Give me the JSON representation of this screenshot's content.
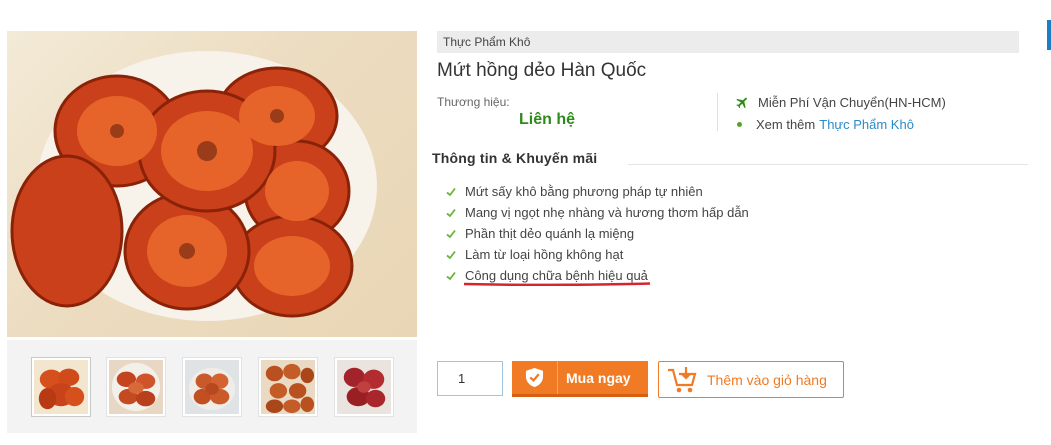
{
  "product": {
    "category": "Thực Phẩm Khô",
    "title": "Mứt hồng dẻo Hàn Quốc",
    "brand_label": "Thương hiệu:",
    "brand_value": "Liên hệ"
  },
  "shipping": {
    "free_shipping": "Miễn Phí Vận Chuyển(HN-HCM)",
    "see_more_prefix": "Xem thêm",
    "see_more_link": "Thực Phẩm Khô"
  },
  "info": {
    "section_title": "Thông tin & Khuyến mãi",
    "features": [
      "Mứt sấy khô bằng phương pháp tự nhiên",
      "Mang vị ngọt nhẹ nhàng và hương thơm hấp dẫn",
      "Phần thịt dẻo quánh lạ miệng",
      "Làm từ loại hồng không hạt",
      "Công dụng chữa bệnh hiệu quả"
    ]
  },
  "purchase": {
    "quantity": "1",
    "buy_now": "Mua ngay",
    "add_to_cart": "Thêm vào giỏ hàng"
  },
  "icons": {
    "plane": "plane-icon",
    "check": "check-icon",
    "shield": "shield-check-icon",
    "cart": "cart-add-icon"
  },
  "colors": {
    "accent_orange": "#f07b24",
    "brand_green": "#2e8b1a",
    "link_blue": "#2a8bc7",
    "underline_red": "#d9232e"
  }
}
